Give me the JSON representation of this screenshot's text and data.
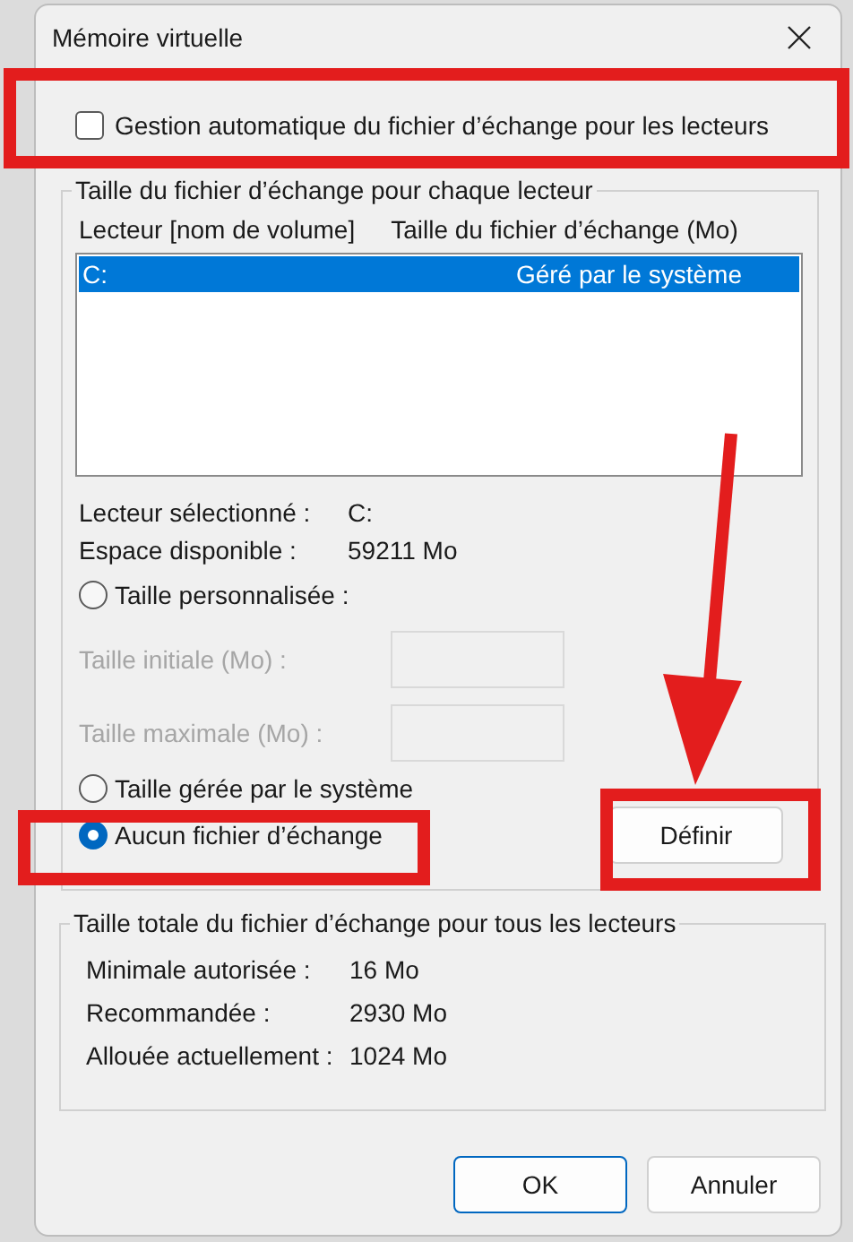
{
  "window": {
    "title": "Mémoire virtuelle"
  },
  "auto_manage": {
    "label": "Gestion automatique du fichier d’échange pour les lecteurs",
    "checked": false
  },
  "drive_group": {
    "title": "Taille du fichier d’échange pour chaque lecteur",
    "columns": [
      "Lecteur [nom de volume]",
      "Taille du fichier d’échange (Mo)"
    ],
    "drives": [
      {
        "drive": "C:",
        "size": "Géré par le système",
        "selected": true
      }
    ],
    "info": [
      {
        "label": "Lecteur sélectionné :",
        "value": "C:"
      },
      {
        "label": "Espace disponible :",
        "value": "59211 Mo"
      }
    ],
    "custom_size": {
      "label": "Taille personnalisée :",
      "selected": false
    },
    "size_fields": [
      {
        "label": "Taille initiale (Mo) :",
        "disabled": true
      },
      {
        "label": "Taille maximale (Mo) :",
        "disabled": true
      }
    ],
    "other_options": [
      {
        "label": "Taille gérée par le système",
        "selected": false
      },
      {
        "label": "Aucun fichier d’échange",
        "selected": true
      }
    ],
    "set_button": "Définir"
  },
  "totals": {
    "title": "Taille totale du fichier d’échange pour tous les lecteurs",
    "rows": [
      {
        "label": "Minimale autorisée :",
        "value": "16 Mo"
      },
      {
        "label": "Recommandée :",
        "value": "2930 Mo"
      },
      {
        "label": "Allouée actuellement :",
        "value": "1024 Mo"
      }
    ]
  },
  "buttons": [
    {
      "label": "OK",
      "default": true
    },
    {
      "label": "Annuler",
      "default": false
    }
  ]
}
